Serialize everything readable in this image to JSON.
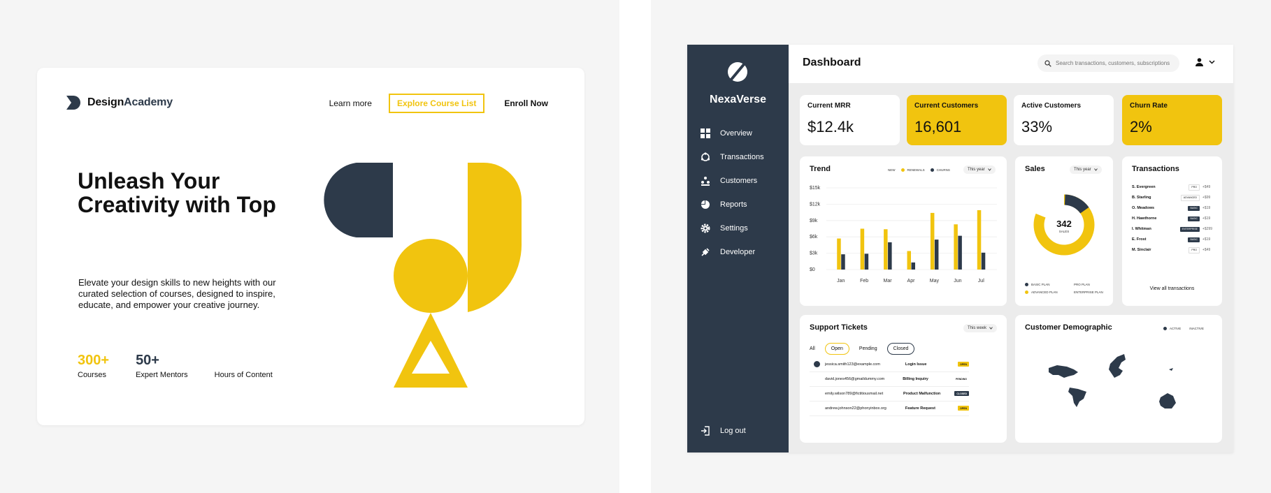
{
  "colors": {
    "accent": "#f1c40f",
    "navy": "#2d3a4a"
  },
  "landing": {
    "brand": {
      "bold": "Design",
      "accent": "Academy"
    },
    "nav": {
      "learn": "Learn more",
      "explore": "Explore Course List",
      "enroll": "Enroll Now"
    },
    "title": "Unleash Your Creativity with Top",
    "subtitle": "Elevate your design skills to new heights with our curated selection of courses, designed to inspire, educate, and empower your creative journey.",
    "stats": [
      {
        "value": "300+",
        "label": "Courses"
      },
      {
        "value": "50+",
        "label": "Expert Mentors"
      },
      {
        "value": "",
        "label": "Hours of Content"
      }
    ]
  },
  "dashboard": {
    "brand": "NexaVerse",
    "menu": [
      "Overview",
      "Transactions",
      "Customers",
      "Reports",
      "Settings",
      "Developer"
    ],
    "logout": "Log out",
    "title": "Dashboard",
    "search_placeholder": "Search transactions, customers, subscriptions",
    "kpis": [
      {
        "title": "Current MRR",
        "value": "$12.4k"
      },
      {
        "title": "Current Customers",
        "value": "16,601"
      },
      {
        "title": "Active Customers",
        "value": "33%"
      },
      {
        "title": "Churn Rate",
        "value": "2%"
      }
    ],
    "trend": {
      "title": "Trend",
      "legend": [
        "NEW",
        "RENEWALS",
        "CHURNS"
      ],
      "period": "This year"
    },
    "sales": {
      "title": "Sales",
      "period": "This year",
      "center_value": "342",
      "center_label": "SALES",
      "legend": [
        "BASIC PLAN",
        "PRO PLAN",
        "ADVANCED PLAN",
        "ENTERPRISE PLAN"
      ]
    },
    "transactions": {
      "title": "Transactions",
      "rows": [
        {
          "name": "S. Evergreen",
          "plan": "PRO",
          "amount": "+$49"
        },
        {
          "name": "B. Starling",
          "plan": "ADVANCED",
          "amount": "+$99"
        },
        {
          "name": "O. Meadows",
          "plan": "BASIC",
          "amount": "+$19"
        },
        {
          "name": "H. Hawthorne",
          "plan": "BASIC",
          "amount": "+$19"
        },
        {
          "name": "I. Whitman",
          "plan": "ENTERPRISE",
          "amount": "+$299"
        },
        {
          "name": "E. Frost",
          "plan": "BASIC",
          "amount": "+$19"
        },
        {
          "name": "M. Sinclair",
          "plan": "PRO",
          "amount": "+$49"
        }
      ],
      "view_all": "View all transactions"
    },
    "tickets": {
      "title": "Support Tickets",
      "period": "This week",
      "tabs": [
        "All",
        "Open",
        "Pending",
        "Closed"
      ],
      "rows": [
        {
          "email": "jessica.smith123@example.com",
          "issue": "Login Issue",
          "status": "OPEN"
        },
        {
          "email": "david.jones456@gmaildummy.com",
          "issue": "Billing Inquiry",
          "status": "PENDING"
        },
        {
          "email": "emily.wilson789@fictitiousmail.net",
          "issue": "Product Malfunction",
          "status": "CLOSED"
        },
        {
          "email": "andrew.johnson22@phonyinbox.org",
          "issue": "Feature Request",
          "status": "OPEN"
        }
      ]
    },
    "demographic": {
      "title": "Customer Demographic",
      "legend": [
        "ACTIVE",
        "INACTIVE"
      ]
    }
  },
  "chart_data": {
    "type": "bar",
    "categories": [
      "Jan",
      "Feb",
      "Mar",
      "Apr",
      "May",
      "Jun",
      "Jul"
    ],
    "series": [
      {
        "name": "RENEWALS",
        "values": [
          5700,
          7500,
          7400,
          3400,
          10400,
          8300,
          10900
        ]
      },
      {
        "name": "CHURNS",
        "values": [
          2800,
          2900,
          5000,
          1300,
          5500,
          6200,
          3100
        ]
      }
    ],
    "yticks": [
      "$0",
      "$3k",
      "$6k",
      "$9k",
      "$12k",
      "$15k"
    ],
    "ylim": [
      0,
      15000
    ]
  }
}
